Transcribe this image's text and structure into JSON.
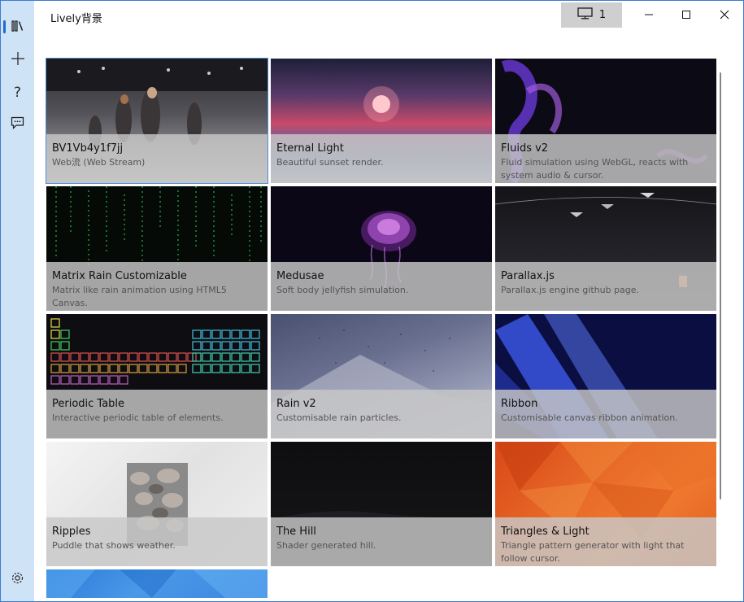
{
  "app": {
    "title": "Lively背景"
  },
  "monitor": {
    "count": "1",
    "icon": "monitor-icon"
  },
  "sidebar": {
    "items": [
      {
        "name": "library",
        "icon": "library-icon"
      },
      {
        "name": "add-wallpaper",
        "icon": "plus-icon"
      },
      {
        "name": "help",
        "icon": "help-icon"
      },
      {
        "name": "feedback",
        "icon": "feedback-icon"
      }
    ],
    "settings": {
      "icon": "gear-icon"
    }
  },
  "wallpapers": [
    {
      "title": "BV1Vb4y1f7jj",
      "desc": "Web流 (Web Stream)"
    },
    {
      "title": "Eternal Light",
      "desc": "Beautiful sunset render."
    },
    {
      "title": "Fluids v2",
      "desc": "Fluid simulation using WebGL, reacts with system audio & cursor."
    },
    {
      "title": "Matrix Rain Customizable",
      "desc": "Matrix like rain animation using HTML5 Canvas."
    },
    {
      "title": "Medusae",
      "desc": "Soft body jellyfish simulation."
    },
    {
      "title": "Parallax.js",
      "desc": "Parallax.js engine github page."
    },
    {
      "title": "Periodic Table",
      "desc": "Interactive periodic table of elements."
    },
    {
      "title": "Rain v2",
      "desc": "Customisable rain particles."
    },
    {
      "title": "Ribbon",
      "desc": "Customisable canvas ribbon animation."
    },
    {
      "title": "Ripples",
      "desc": "Puddle that shows weather."
    },
    {
      "title": "The Hill",
      "desc": "Shader generated hill."
    },
    {
      "title": "Triangles & Light",
      "desc": "Triangle pattern generator with light that follow cursor."
    }
  ]
}
